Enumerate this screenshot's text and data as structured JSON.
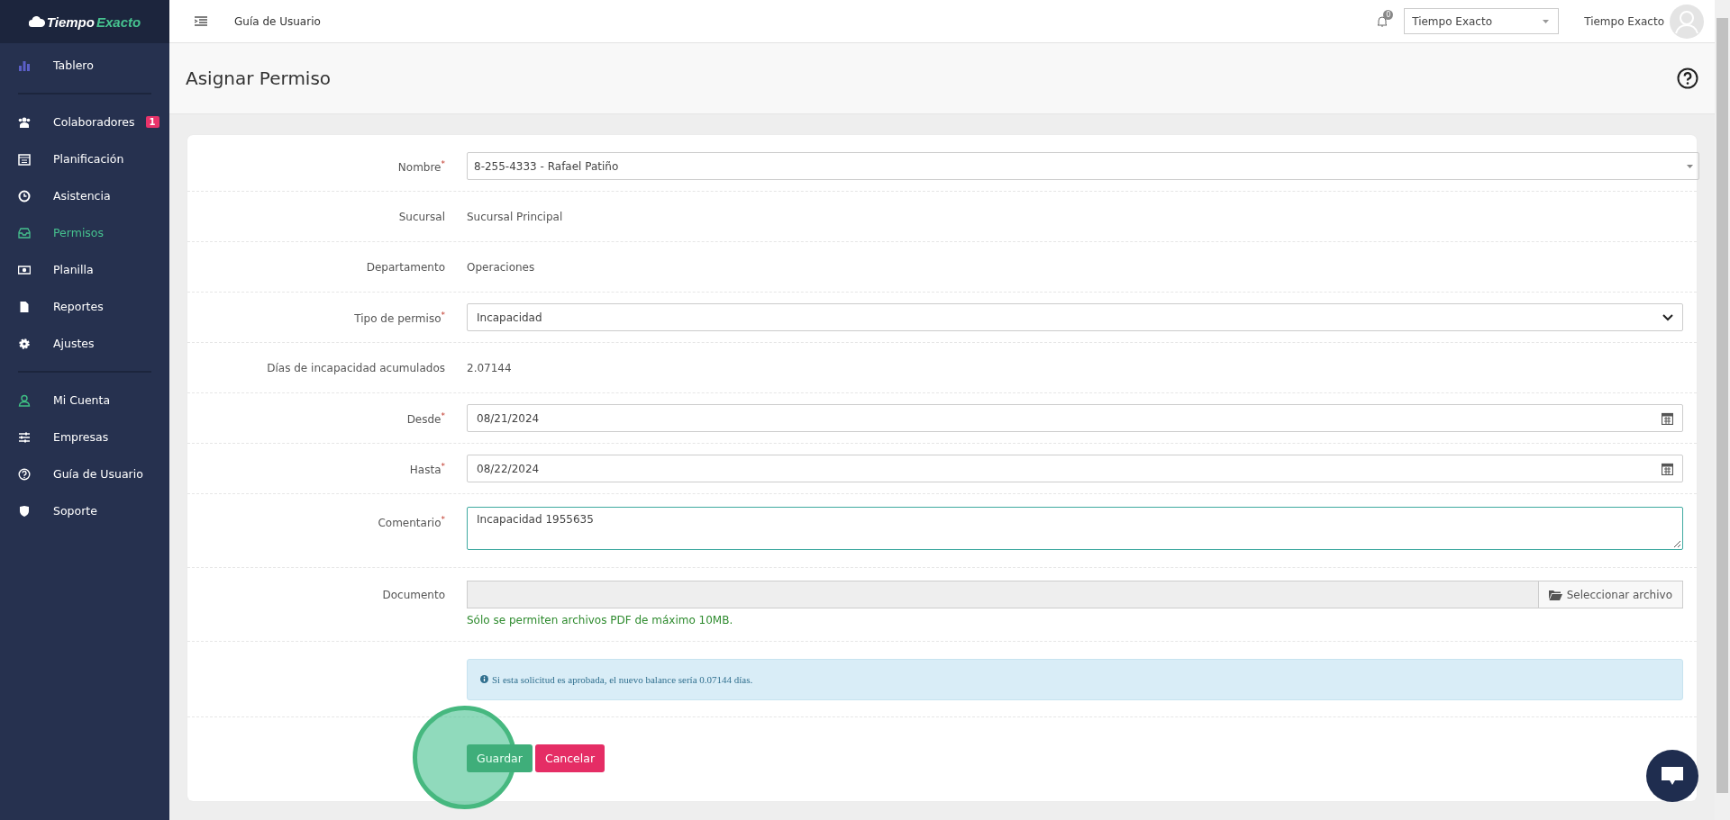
{
  "sidebar": {
    "logo": {
      "first": "Tiempo",
      "second": "Exacto"
    },
    "groups": [
      [
        {
          "label": "Tablero",
          "kind": "chart",
          "selected": false
        }
      ],
      [
        {
          "label": "Colaboradores",
          "kind": "users",
          "selected": false,
          "badge": "1"
        },
        {
          "label": "Planificación",
          "kind": "calendar",
          "selected": false
        },
        {
          "label": "Asistencia",
          "kind": "clock",
          "selected": false
        },
        {
          "label": "Permisos",
          "kind": "inbox",
          "selected": true
        },
        {
          "label": "Planilla",
          "kind": "money",
          "selected": false
        },
        {
          "label": "Reportes",
          "kind": "file",
          "selected": false
        },
        {
          "label": "Ajustes",
          "kind": "gear",
          "selected": false
        }
      ],
      [
        {
          "label": "Mi Cuenta",
          "kind": "user",
          "selected": false
        },
        {
          "label": "Empresas",
          "kind": "sliders",
          "selected": false
        },
        {
          "label": "Guía de Usuario",
          "kind": "question",
          "selected": false
        },
        {
          "label": "Soporte",
          "kind": "shield",
          "selected": false
        }
      ]
    ]
  },
  "topbar": {
    "link": "Guía de Usuario",
    "notifications": "0",
    "company_select": "Tiempo Exacto",
    "user_name": "Tiempo Exacto"
  },
  "page": {
    "title": "Asignar Permiso"
  },
  "form": {
    "rows": [
      {
        "kind": "combo",
        "label": "Nombre$^{*}$",
        "value": "8-255-4333 - Rafael Patiño"
      },
      {
        "kind": "static",
        "label": "Sucursal",
        "value": "Sucursal Principal"
      },
      {
        "kind": "static",
        "label": "Departamento",
        "value": "Operaciones"
      },
      {
        "kind": "select",
        "label": "Tipo de permiso$^{*}$",
        "value": "Incapacidad"
      },
      {
        "kind": "static",
        "label": "Días de incapacidad acumulados",
        "value": "2.07144"
      },
      {
        "kind": "date",
        "label": "Desde$^{*}$",
        "value": "08/21/2024"
      },
      {
        "kind": "date",
        "label": "Hasta$^{*}$",
        "value": "08/22/2024"
      },
      {
        "kind": "textarea",
        "label": "Comentario$^{*}$",
        "value": "Incapacidad 1955635"
      },
      {
        "kind": "file",
        "label": "Documento",
        "button": "Seleccionar archivo",
        "help": "Sólo se permiten archivos PDF de máximo 10MB."
      },
      {
        "kind": "alert",
        "text": "Si esta solicitud es aprobada, el nuevo balance sería 0.07144 días."
      }
    ],
    "buttons": [
      {
        "label": "Guardar",
        "kind": "save"
      },
      {
        "label": "Cancelar",
        "kind": "cancel"
      }
    ]
  }
}
